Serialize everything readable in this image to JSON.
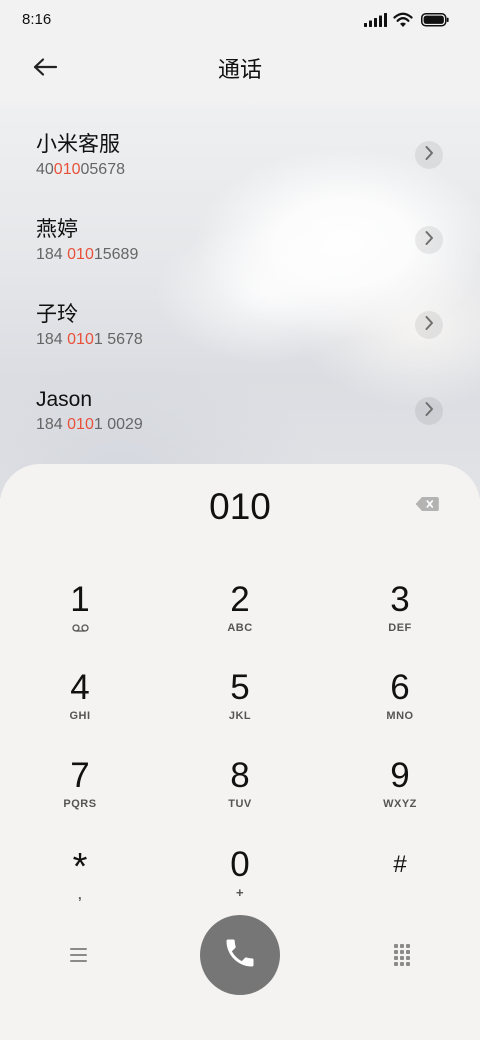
{
  "status_bar": {
    "time": "8:16",
    "icons": [
      "signal-icon",
      "wifi-icon",
      "battery-icon"
    ]
  },
  "header": {
    "title": "通话",
    "back_icon": "arrow-left-icon"
  },
  "contacts": [
    {
      "name": "小米客服",
      "number_before": "40",
      "number_match": "010",
      "number_after": "05678"
    },
    {
      "name": "燕婷",
      "number_before": "184 ",
      "number_match": "010",
      "number_after": "15689"
    },
    {
      "name": "子玲",
      "number_before": "184 ",
      "number_match": "010",
      "number_after": "1 5678"
    },
    {
      "name": "Jason",
      "number_before": "184 ",
      "number_match": "010",
      "number_after": "1 0029"
    }
  ],
  "dialer": {
    "input": "010",
    "backspace_icon": "backspace-icon",
    "keys": [
      {
        "digit": "1",
        "sub_icon": "voicemail-icon"
      },
      {
        "digit": "2",
        "sub": "ABC"
      },
      {
        "digit": "3",
        "sub": "DEF"
      },
      {
        "digit": "4",
        "sub": "GHI"
      },
      {
        "digit": "5",
        "sub": "JKL"
      },
      {
        "digit": "6",
        "sub": "MNO"
      },
      {
        "digit": "7",
        "sub": "PQRS"
      },
      {
        "digit": "8",
        "sub": "TUV"
      },
      {
        "digit": "9",
        "sub": "WXYZ"
      },
      {
        "digit": "*",
        "sub": ","
      },
      {
        "digit": "0",
        "sub": "+"
      },
      {
        "digit": "#"
      }
    ]
  },
  "bottom_bar": {
    "menu_icon": "menu-icon",
    "call_icon": "phone-icon",
    "keypad_icon": "dialpad-icon"
  },
  "colors": {
    "match_highlight": "#e8513a",
    "call_button": "#767676",
    "dialer_bg": "#f4f3f1",
    "page_bg": "#f2f2f2"
  }
}
